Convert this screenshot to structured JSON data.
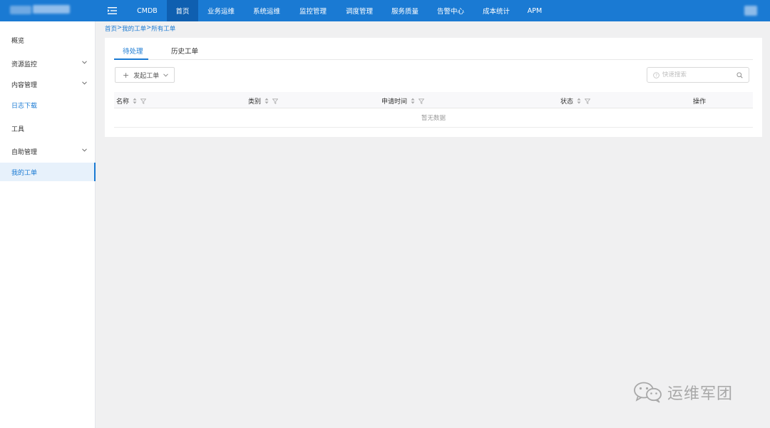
{
  "topnav": {
    "items": [
      "CMDB",
      "首页",
      "业务运维",
      "系统运维",
      "监控管理",
      "调度管理",
      "服务质量",
      "告警中心",
      "成本统计",
      "APM"
    ],
    "active_index": 1
  },
  "sidebar": {
    "items": [
      {
        "label": "概览",
        "expandable": false
      },
      {
        "label": "资源监控",
        "expandable": true
      },
      {
        "label": "内容管理",
        "expandable": true
      },
      {
        "label": "日志下载",
        "expandable": false
      },
      {
        "label": "工具",
        "expandable": false
      },
      {
        "label": "自助管理",
        "expandable": true
      },
      {
        "label": "我的工单",
        "expandable": false
      }
    ],
    "highlight_index": 3,
    "active_index": 6
  },
  "breadcrumb": [
    "首页",
    "我的工单",
    "所有工单"
  ],
  "tabs": {
    "items": [
      "待处理",
      "历史工单"
    ],
    "active_index": 0
  },
  "toolbar": {
    "create_label": "发起工单",
    "search_placeholder": "快速搜索"
  },
  "table": {
    "columns": [
      "名称",
      "类别",
      "申请时间",
      "状态",
      "操作"
    ],
    "empty_text": "暂无数据"
  },
  "watermark": {
    "text": "运维军团"
  },
  "colors": {
    "primary": "#1a7ad3",
    "nav_active": "#0f5fb0",
    "sidebar_active_bg": "#e7f1fb"
  }
}
